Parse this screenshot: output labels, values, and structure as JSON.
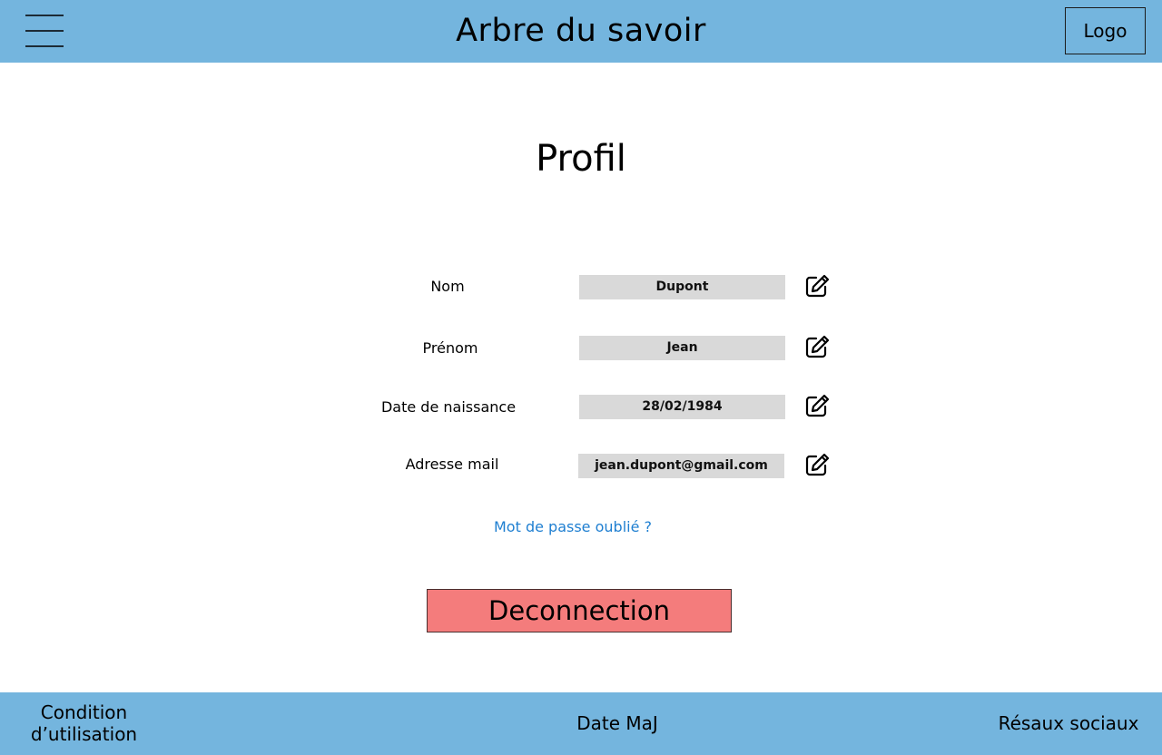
{
  "header": {
    "title": "Arbre du savoir",
    "logo_label": "Logo",
    "menu_icon": "hamburger-menu-icon"
  },
  "main": {
    "title": "Profil",
    "fields": [
      {
        "label": "Nom",
        "value": "Dupont",
        "edit_icon": "edit-icon"
      },
      {
        "label": "Prénom",
        "value": "Jean",
        "edit_icon": "edit-icon"
      },
      {
        "label": "Date de naissance",
        "value": "28/02/1984",
        "edit_icon": "edit-icon"
      },
      {
        "label": "Adresse mail",
        "value": "jean.dupont@gmail.com",
        "edit_icon": "edit-icon"
      }
    ],
    "forgot_password": "Mot de passe oublié ?",
    "logout_label": "Deconnection"
  },
  "footer": {
    "terms_line1": "Condition",
    "terms_line2": "d’utilisation",
    "update_label": "Date MaJ",
    "social_label": "Résaux sociaux"
  },
  "colors": {
    "header_bg": "#74b5de",
    "field_bg": "#d9d9d9",
    "logout_bg": "#f47c7c",
    "link": "#1f7fd1"
  }
}
